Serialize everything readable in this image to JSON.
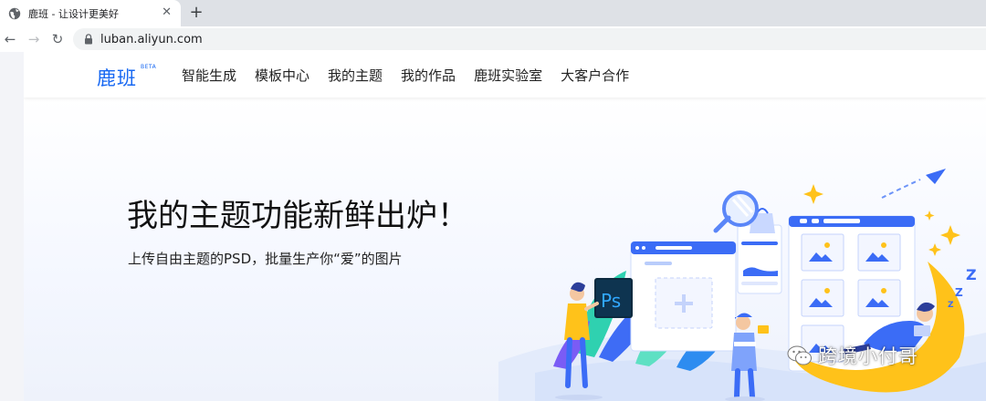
{
  "browser": {
    "tab": {
      "title": "鹿班 - 让设计更美好",
      "close_glyph": "✕"
    },
    "new_tab_glyph": "+",
    "nav": {
      "back": "←",
      "forward": "→",
      "reload": "↻"
    },
    "url": "luban.aliyun.com"
  },
  "site": {
    "logo": "鹿班",
    "logo_badge": "BETA",
    "nav_items": [
      {
        "label": "智能生成"
      },
      {
        "label": "模板中心"
      },
      {
        "label": "我的主题"
      },
      {
        "label": "我的作品"
      },
      {
        "label": "鹿班实验室"
      },
      {
        "label": "大客户合作"
      }
    ],
    "brand_color": "#1667f2"
  },
  "hero": {
    "title": "我的主题功能新鲜出炉！",
    "subtitle": "上传自由主题的PSD，批量生产你“爱”的图片",
    "illustration_ps_label": "Ps",
    "illustration_z": "Z"
  },
  "watermark": {
    "text": "跨境小付哥",
    "icon": "wechat-icon"
  }
}
